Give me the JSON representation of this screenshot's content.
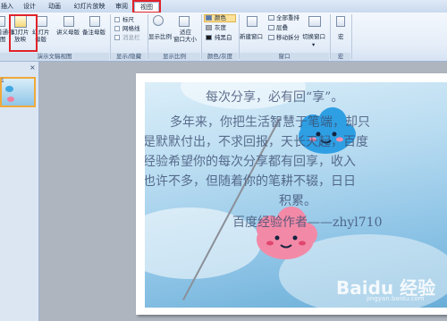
{
  "tabs": [
    "插入",
    "设计",
    "动画",
    "幻灯片放映",
    "审阅",
    "视图"
  ],
  "ribbon": {
    "presentation_views": {
      "normal": "普通视",
      "normal2": "图",
      "sorter": "幻灯片",
      "sorter2": "浏览",
      "notes": "备注页",
      "reading_view": "幻灯片",
      "reading_view2": "放映",
      "slide_master": "幻灯片",
      "slide_master2": "母版",
      "handout_master": "讲义母版",
      "notes_master": "备注母版",
      "group_label": "演示文稿视图"
    },
    "show_hide": {
      "ruler": "标尺",
      "gridlines": "网格线",
      "message_bar": "消息栏",
      "group_label": "显示/隐藏"
    },
    "zoom": {
      "zoom": "显示比例",
      "fit_window": "适应",
      "fit_window2": "窗口大小",
      "group_label": "显示比例"
    },
    "color": {
      "color": "颜色",
      "grayscale": "灰度",
      "black_white": "纯黑白",
      "group_label": "颜色/灰度"
    },
    "window": {
      "new_window": "新建窗口",
      "arrange_all": "全部重排",
      "cascade": "层叠",
      "move_split": "移动拆分",
      "switch_windows": "切换窗口",
      "group_label": "窗口"
    },
    "macro": {
      "macros": "宏",
      "group_label": "宏"
    }
  },
  "left_pane": {
    "close": "×",
    "slide_number": "1"
  },
  "slide": {
    "title": "每次分享，必有回“享”。",
    "lines": [
      "多年来，你把生活智慧于笔端，却只",
      "是默默付出，不求回报，天长天起，百度",
      "经验希望你的每次分享都有回享，收入",
      "也许不多，但随着你的笔耕不辍，日日",
      "积累。"
    ],
    "author": "百度经验作者——zhyl710",
    "watermark": "Baidu 经验",
    "watermark_url": "jingyan.baidu.com"
  },
  "colors": {
    "highlight_red": "#e0232a",
    "ribbon_bg": "#e4edf8",
    "selected_thumb_border": "#f0a93b"
  }
}
